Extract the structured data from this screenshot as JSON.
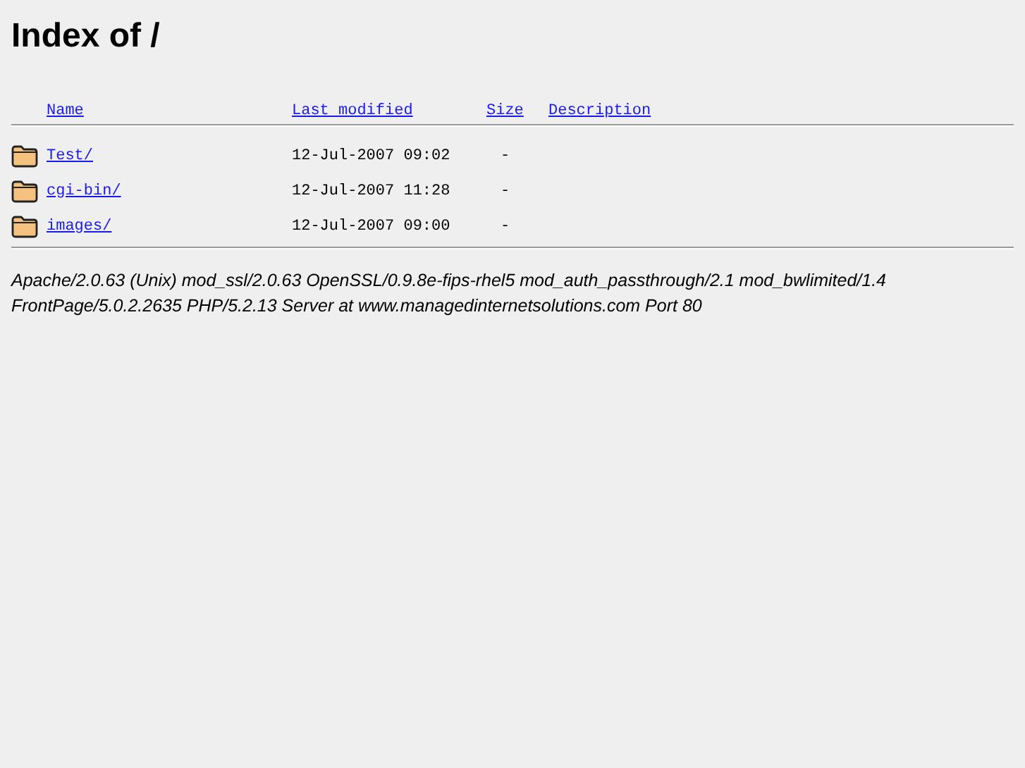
{
  "title": "Index of /",
  "columns": [
    "Name",
    "Last modified",
    "Size",
    "Description"
  ],
  "rows": [
    {
      "name": "Test/",
      "modified": "12-Jul-2007 09:02",
      "size": "-"
    },
    {
      "name": "cgi-bin/",
      "modified": "12-Jul-2007 11:28",
      "size": "-"
    },
    {
      "name": "images/",
      "modified": "12-Jul-2007 09:00",
      "size": "-"
    }
  ],
  "address": [
    "Apache/2.0.63 (Unix) mod_ssl/2.0.63 OpenSSL/0.9.8e-fips-rhel5 mod_auth_passthrough/2.1 mod_bwlimited/1.4",
    "FrontPage/5.0.2.2635 PHP/5.2.13 Server at www.managedinternetsolutions.com Port 80"
  ]
}
